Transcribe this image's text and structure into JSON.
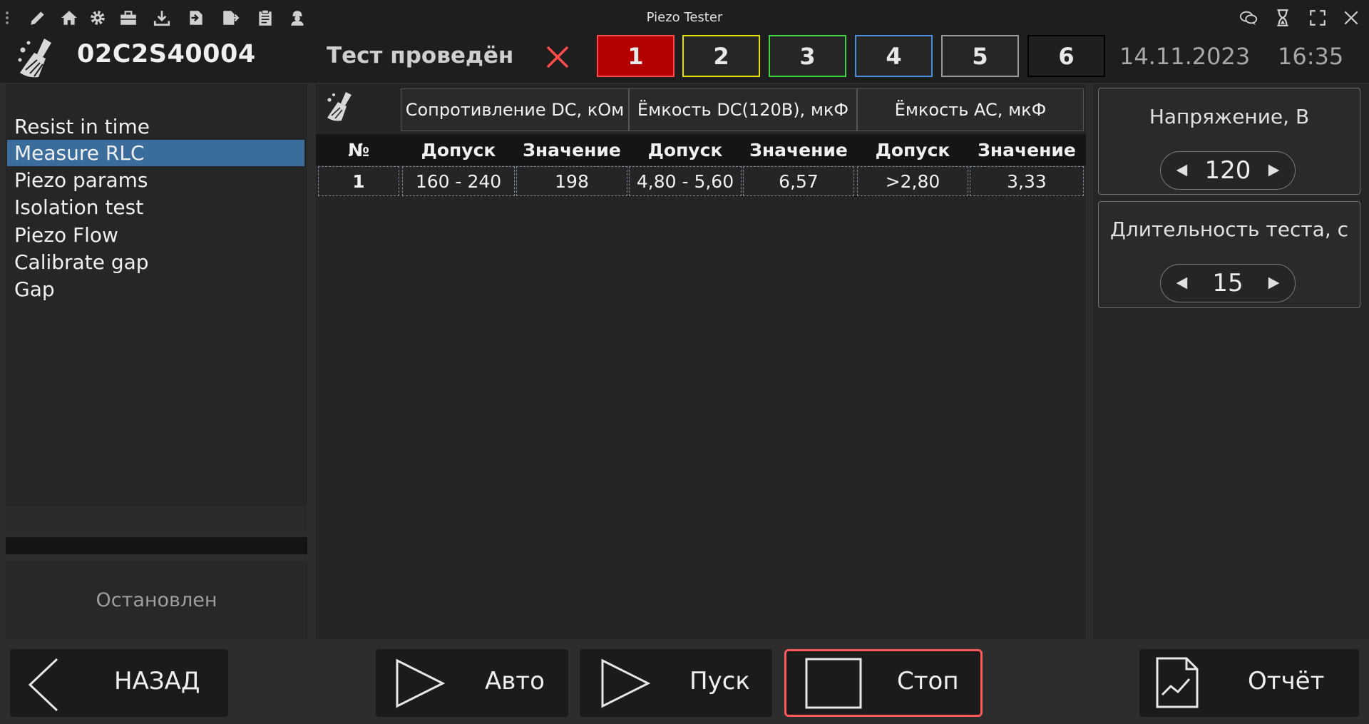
{
  "window": {
    "title": "Piezo Tester"
  },
  "titlebar": {
    "left_icons": [
      "drag-handle-icon",
      "pencil-icon",
      "home-icon",
      "gear-icon",
      "toolbox-icon",
      "download-icon",
      "import-icon",
      "export-icon",
      "clipboard-icon",
      "worker-icon"
    ],
    "right_icons": [
      "chat-icon",
      "hourglass-icon",
      "fullscreen-icon",
      "close-icon"
    ]
  },
  "header": {
    "serial": "02C2S40004",
    "test_status": "Тест проведён",
    "channels": [
      {
        "label": "1",
        "border": "#ff4a4a",
        "bg": "#b30000"
      },
      {
        "label": "2",
        "border": "#e6e000",
        "bg": "#262626"
      },
      {
        "label": "3",
        "border": "#3fd43f",
        "bg": "#262626"
      },
      {
        "label": "4",
        "border": "#4a8ee0",
        "bg": "#262626"
      },
      {
        "label": "5",
        "border": "#9a9a9a",
        "bg": "#262626"
      },
      {
        "label": "6",
        "border": "#000000",
        "bg": "#1f1f1f"
      }
    ],
    "date": "14.11.2023",
    "time": "16:35"
  },
  "left_menu": {
    "items": [
      "Resist in time",
      "Measure RLC",
      "Piezo params",
      "Isolation test",
      "Piezo Flow",
      "Calibrate gap",
      "Gap"
    ],
    "selected": 1
  },
  "status": {
    "text": "Остановлен"
  },
  "table": {
    "groups": [
      "Сопротивление DC, кОм",
      "Ёмкость DC(120B), мкФ",
      "Ёмкость AC, мкФ"
    ],
    "columns": [
      "№",
      "Допуск",
      "Значение",
      "Допуск",
      "Значение",
      "Допуск",
      "Значение"
    ],
    "rows": [
      [
        "1",
        "160 - 240",
        "198",
        "4,80 - 5,60",
        "6,57",
        ">2,80",
        "3,33"
      ]
    ]
  },
  "settings": {
    "voltage": {
      "label": "Напряжение, В",
      "value": "120"
    },
    "duration": {
      "label": "Длительность теста, с",
      "value": "15"
    }
  },
  "buttons": {
    "back": "НАЗАД",
    "auto": "Авто",
    "start": "Пуск",
    "stop": "Стоп",
    "report": "Отчёт"
  },
  "colors": {
    "accent_select": "#3a6d9c",
    "stop_border": "#ff5a5a",
    "cross": "#ff4a4a"
  }
}
